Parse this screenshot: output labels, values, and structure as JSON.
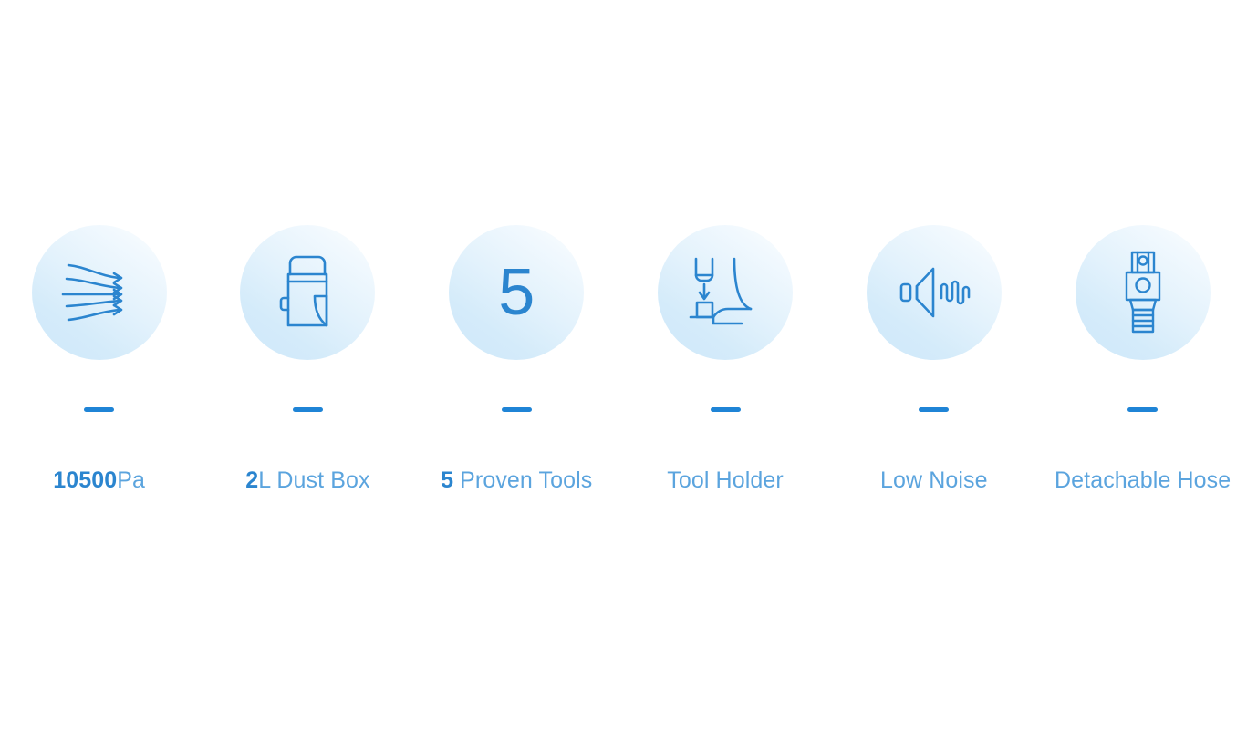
{
  "page": {
    "background_color": "#ffffff",
    "accent_color": "#1f84d6",
    "bold_text_color": "#2b85cf",
    "regular_text_color": "#5ba4de",
    "circle_gradient_from": "#ffffff",
    "circle_gradient_to": "#cfe8f9"
  },
  "features": [
    {
      "icon_name": "airflow-icon",
      "lead": "10500",
      "rest": "Pa",
      "full_label": "10500Pa"
    },
    {
      "icon_name": "dust-box-icon",
      "lead": "2",
      "rest": "L Dust Box",
      "full_label": "2L Dust Box"
    },
    {
      "icon_name": "number-five-icon",
      "icon_text": "5",
      "lead": "5",
      "rest": " Proven Tools",
      "full_label": "5 Proven Tools"
    },
    {
      "icon_name": "tool-holder-icon",
      "lead": "",
      "rest": "Tool Holder",
      "full_label": "Tool Holder"
    },
    {
      "icon_name": "low-noise-speaker-icon",
      "lead": "",
      "rest": "Low Noise",
      "full_label": "Low Noise"
    },
    {
      "icon_name": "detachable-hose-icon",
      "lead": "",
      "rest": "Detachable Hose",
      "full_label": "Detachable Hose"
    }
  ]
}
